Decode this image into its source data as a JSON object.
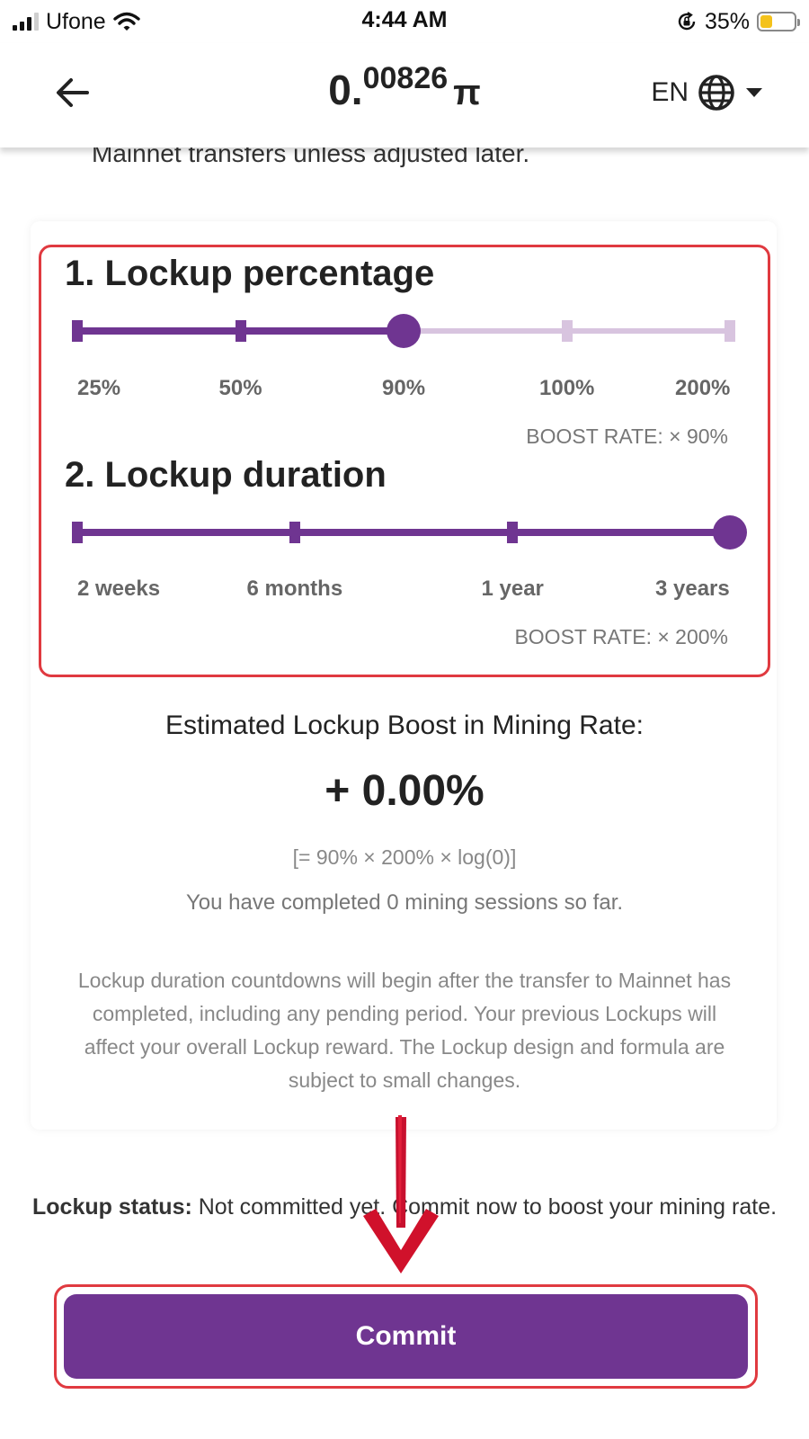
{
  "status_bar": {
    "carrier": "Ufone",
    "time": "4:44 AM",
    "battery": "35%",
    "battery_level": 0.35
  },
  "header": {
    "balance_int": "0.",
    "balance_frac": "00826",
    "balance_unit": "π",
    "language": "EN"
  },
  "intro_cut_text": "Mainnet transfers unless adjusted later.",
  "lockup_percentage": {
    "title": "1. Lockup percentage",
    "options": [
      "25%",
      "50%",
      "90%",
      "100%",
      "200%"
    ],
    "selected_index": 2,
    "boost": "BOOST RATE: × 90%"
  },
  "lockup_duration": {
    "title": "2. Lockup duration",
    "options": [
      "2 weeks",
      "6 months",
      "1 year",
      "3 years"
    ],
    "selected_index": 3,
    "boost": "BOOST RATE: × 200%"
  },
  "estimate": {
    "title": "Estimated Lockup Boost in Mining Rate:",
    "value": "+ 0.00%",
    "formula": "[= 90% × 200% × log(0)]",
    "sessions": "You have completed 0 mining sessions so far."
  },
  "disclaimer": "Lockup duration countdowns will begin after the transfer to Mainnet has completed, including any pending period. Your previous Lockups will affect your overall Lockup reward. The Lockup design and formula are subject to small changes.",
  "lockup_status": {
    "label": "Lockup status:",
    "text": "Not committed yet. Commit now to boost your mining rate."
  },
  "commit_button": "Commit",
  "colors": {
    "accent": "#6f3591",
    "accent_light": "#d8c4df",
    "highlight": "#e03a40",
    "battery": "#f4c21b"
  }
}
